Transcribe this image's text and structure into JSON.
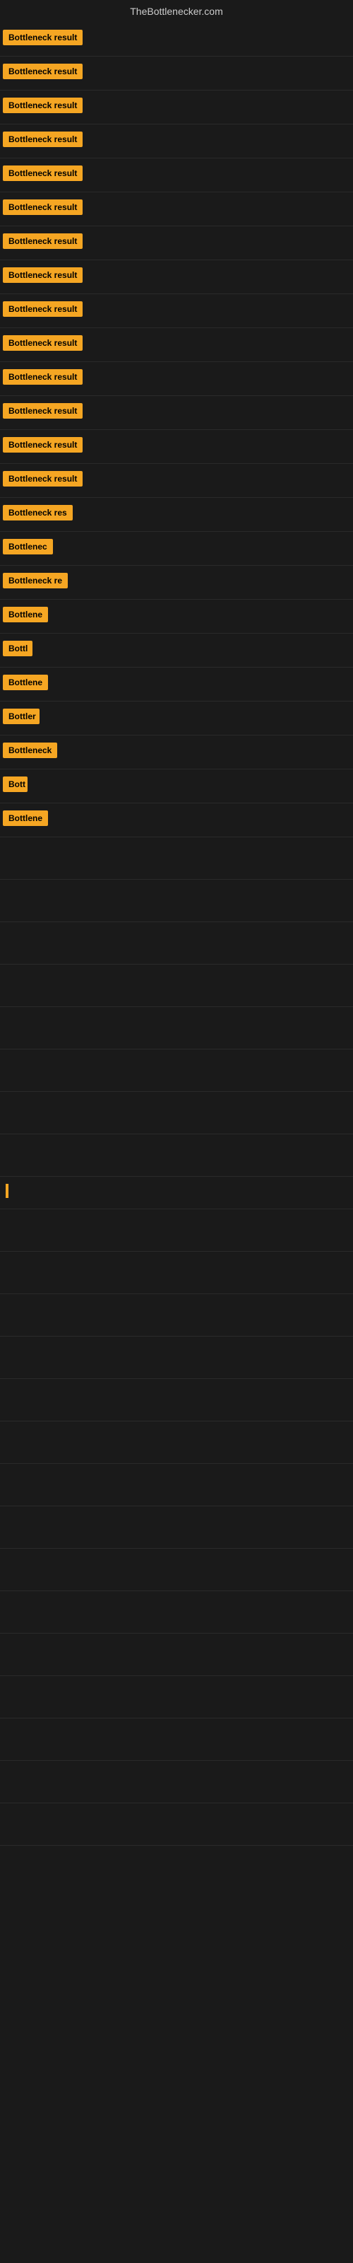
{
  "site": {
    "title": "TheBottlenecker.com"
  },
  "rows": [
    {
      "label": "Bottleneck result",
      "width": "full"
    },
    {
      "label": "Bottleneck result",
      "width": "full"
    },
    {
      "label": "Bottleneck result",
      "width": "full"
    },
    {
      "label": "Bottleneck result",
      "width": "full"
    },
    {
      "label": "Bottleneck result",
      "width": "full"
    },
    {
      "label": "Bottleneck result",
      "width": "full"
    },
    {
      "label": "Bottleneck result",
      "width": "full"
    },
    {
      "label": "Bottleneck result",
      "width": "full"
    },
    {
      "label": "Bottleneck result",
      "width": "full"
    },
    {
      "label": "Bottleneck result",
      "width": "full"
    },
    {
      "label": "Bottleneck result",
      "width": "full"
    },
    {
      "label": "Bottleneck result",
      "width": "full"
    },
    {
      "label": "Bottleneck result",
      "width": "full"
    },
    {
      "label": "Bottleneck result",
      "width": "full"
    },
    {
      "label": "Bottleneck res",
      "width": "partial1"
    },
    {
      "label": "Bottlenec",
      "width": "partial2"
    },
    {
      "label": "Bottleneck re",
      "width": "partial3"
    },
    {
      "label": "Bottlene",
      "width": "partial4"
    },
    {
      "label": "Bottl",
      "width": "partial5"
    },
    {
      "label": "Bottlene",
      "width": "partial4"
    },
    {
      "label": "Bottler",
      "width": "partial6"
    },
    {
      "label": "Bottleneck",
      "width": "partial7"
    },
    {
      "label": "Bott",
      "width": "partial8"
    },
    {
      "label": "Bottlene",
      "width": "partial4"
    }
  ]
}
